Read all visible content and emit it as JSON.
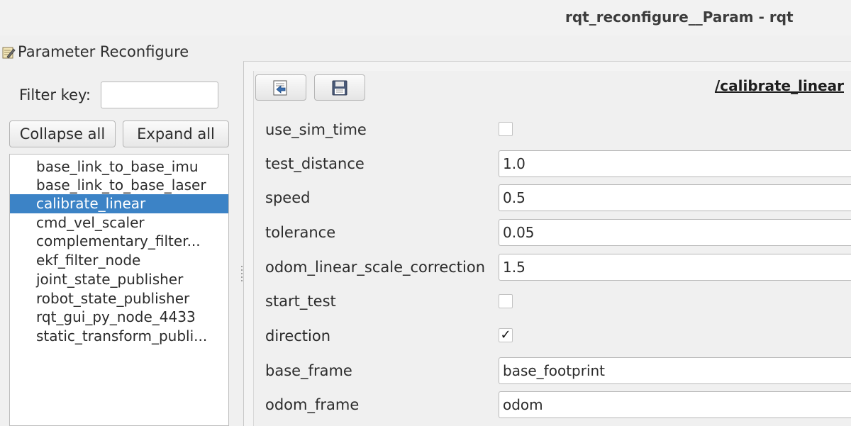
{
  "window": {
    "title": "rqt_reconfigure__Param - rqt"
  },
  "dock": {
    "title": "Parameter Reconfigure",
    "icon": "edit-note-icon"
  },
  "filter": {
    "label": "Filter key:",
    "value": ""
  },
  "buttons": {
    "collapse_all": "Collapse all",
    "expand_all": "Expand all"
  },
  "nodes": [
    {
      "label": "base_link_to_base_imu",
      "selected": false
    },
    {
      "label": "base_link_to_base_laser",
      "selected": false
    },
    {
      "label": "calibrate_linear",
      "selected": true
    },
    {
      "label": "cmd_vel_scaler",
      "selected": false
    },
    {
      "label": "complementary_filter...",
      "selected": false
    },
    {
      "label": "ekf_filter_node",
      "selected": false
    },
    {
      "label": "joint_state_publisher",
      "selected": false
    },
    {
      "label": "robot_state_publisher",
      "selected": false
    },
    {
      "label": "rqt_gui_py_node_4433",
      "selected": false
    },
    {
      "label": "static_transform_publi...",
      "selected": false
    }
  ],
  "toolbar": {
    "load_icon": "load-file-icon",
    "save_icon": "save-floppy-icon"
  },
  "current_node": "/calibrate_linear",
  "params": [
    {
      "name": "use_sim_time",
      "type": "bool",
      "checked": false
    },
    {
      "name": "test_distance",
      "type": "text",
      "value": "1.0"
    },
    {
      "name": "speed",
      "type": "text",
      "value": "0.5"
    },
    {
      "name": "tolerance",
      "type": "text",
      "value": "0.05"
    },
    {
      "name": "odom_linear_scale_correction",
      "type": "text",
      "value": "1.5"
    },
    {
      "name": "start_test",
      "type": "bool",
      "checked": false
    },
    {
      "name": "direction",
      "type": "bool",
      "checked": true,
      "mark": "✓"
    },
    {
      "name": "base_frame",
      "type": "text",
      "value": "base_footprint"
    },
    {
      "name": "odom_frame",
      "type": "text",
      "value": "odom"
    }
  ],
  "colors": {
    "selection": "#3c83c6",
    "background": "#f0f0f0"
  }
}
